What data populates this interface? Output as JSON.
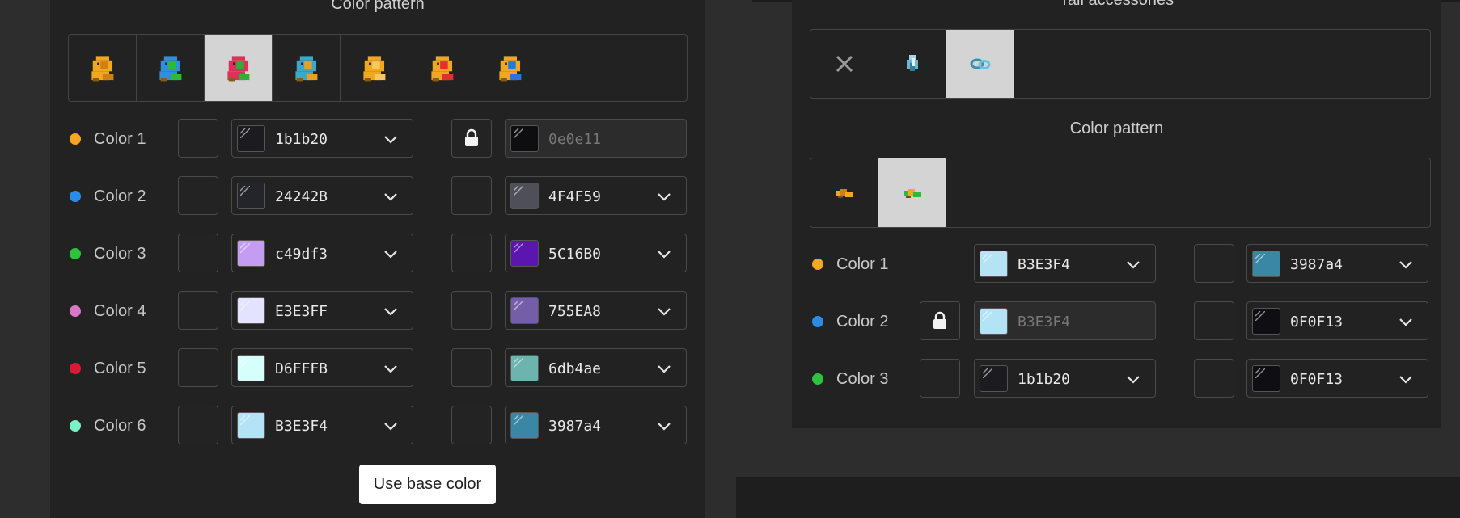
{
  "left": {
    "heading": "Color pattern",
    "patterns": [
      {
        "selected": false,
        "colors": [
          "#f0a81e",
          "#d08010"
        ]
      },
      {
        "selected": false,
        "colors": [
          "#2f8fd8",
          "#2bbb3a"
        ]
      },
      {
        "selected": true,
        "colors": [
          "#e0305a",
          "#2fae3a"
        ]
      },
      {
        "selected": false,
        "colors": [
          "#3aa9c9",
          "#e8a020"
        ]
      },
      {
        "selected": false,
        "colors": [
          "#f0a81e",
          "#f7c860"
        ]
      },
      {
        "selected": false,
        "colors": [
          "#f0a81e",
          "#e03030"
        ]
      },
      {
        "selected": false,
        "colors": [
          "#f0a81e",
          "#3070e0"
        ]
      }
    ],
    "rows": [
      {
        "label": "Color 1",
        "dot": "#f5a623",
        "base_hex": "1b1b20",
        "base_swatch": "#1b1b20",
        "locked": true,
        "alt_hex": "0e0e11",
        "alt_swatch": "#0e0e11",
        "alt_disabled": true
      },
      {
        "label": "Color 2",
        "dot": "#2b8ce8",
        "base_hex": "24242B",
        "base_swatch": "#24242b",
        "locked": false,
        "alt_hex": "4F4F59",
        "alt_swatch": "#4f4f59",
        "alt_disabled": false
      },
      {
        "label": "Color 3",
        "dot": "#2ec23f",
        "base_hex": "c49df3",
        "base_swatch": "#c49df3",
        "locked": false,
        "alt_hex": "5C16B0",
        "alt_swatch": "#5c16b0",
        "alt_disabled": false
      },
      {
        "label": "Color 4",
        "dot": "#d977c8",
        "base_hex": "E3E3FF",
        "base_swatch": "#e3e3ff",
        "locked": false,
        "alt_hex": "755EA8",
        "alt_swatch": "#755ea8",
        "alt_disabled": false
      },
      {
        "label": "Color 5",
        "dot": "#d91a36",
        "base_hex": "D6FFFB",
        "base_swatch": "#d6fffb",
        "locked": false,
        "alt_hex": "6db4ae",
        "alt_swatch": "#6db4ae",
        "alt_disabled": false
      },
      {
        "label": "Color 6",
        "dot": "#7af2c8",
        "base_hex": "B3E3F4",
        "base_swatch": "#b3e3f4",
        "locked": false,
        "alt_hex": "3987a4",
        "alt_swatch": "#3987a4",
        "alt_disabled": false
      }
    ],
    "use_base_label": "Use base color"
  },
  "right": {
    "top_heading": "Tail accessories",
    "accessories": [
      {
        "icon": "none-x-icon",
        "selected": false
      },
      {
        "icon": "crystal-accessory-icon",
        "selected": false
      },
      {
        "icon": "ring-accessory-icon",
        "selected": true
      }
    ],
    "pattern_heading": "Color pattern",
    "patterns": [
      {
        "selected": false,
        "colors": [
          "#f0a81e",
          "#d08010"
        ]
      },
      {
        "selected": true,
        "colors": [
          "#2bbb3a",
          "#f0a81e"
        ]
      }
    ],
    "rows": [
      {
        "label": "Color 1",
        "dot": "#f5a623",
        "locked": false,
        "base_hex": "B3E3F4",
        "base_swatch": "#b3e3f4",
        "base_disabled": false,
        "alt_hex": "3987a4",
        "alt_swatch": "#3987a4"
      },
      {
        "label": "Color 2",
        "dot": "#2b8ce8",
        "locked": true,
        "base_hex": "B3E3F4",
        "base_swatch": "#b3e3f4",
        "base_disabled": true,
        "alt_hex": "0F0F13",
        "alt_swatch": "#0f0f13"
      },
      {
        "label": "Color 3",
        "dot": "#2ec23f",
        "locked": false,
        "base_hex": "1b1b20",
        "base_swatch": "#1b1b20",
        "base_disabled": false,
        "alt_hex": "0F0F13",
        "alt_swatch": "#0f0f13"
      }
    ]
  }
}
